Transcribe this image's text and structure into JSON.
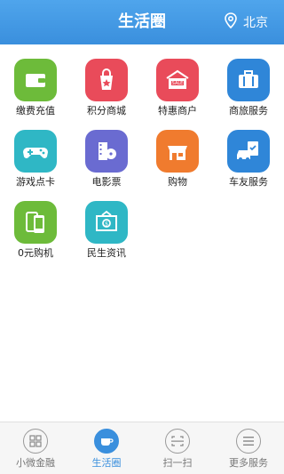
{
  "header": {
    "title": "生活圈",
    "location": "北京",
    "location_icon": "location-pin-icon"
  },
  "colors": {
    "header": "#3a8fdd",
    "accent": "#3a8fdd"
  },
  "services": [
    {
      "label": "缴费充值",
      "icon": "wallet-icon",
      "color": "#6dbb3a"
    },
    {
      "label": "积分商城",
      "icon": "shopping-bag-icon",
      "color": "#e94b5a"
    },
    {
      "label": "特惠商户",
      "icon": "sale-shop-icon",
      "color": "#e94b5a"
    },
    {
      "label": "商旅服务",
      "icon": "suitcase-icon",
      "color": "#2f86d8"
    },
    {
      "label": "游戏点卡",
      "icon": "gamepad-icon",
      "color": "#2fb7c5"
    },
    {
      "label": "电影票",
      "icon": "film-icon",
      "color": "#6a6bd1"
    },
    {
      "label": "购物",
      "icon": "storefront-icon",
      "color": "#f07b2e"
    },
    {
      "label": "车友服务",
      "icon": "car-clipboard-icon",
      "color": "#2f86d8"
    },
    {
      "label": "0元购机",
      "icon": "phones-icon",
      "color": "#6dbb3a"
    },
    {
      "label": "民生资讯",
      "icon": "news-frame-icon",
      "color": "#2fb7c5"
    }
  ],
  "tabs": [
    {
      "label": "小微金融",
      "icon": "grid-icon"
    },
    {
      "label": "生活圈",
      "icon": "coffee-cup-icon"
    },
    {
      "label": "扫一扫",
      "icon": "scan-icon"
    },
    {
      "label": "更多服务",
      "icon": "menu-icon"
    }
  ],
  "active_tab": "生活圈"
}
